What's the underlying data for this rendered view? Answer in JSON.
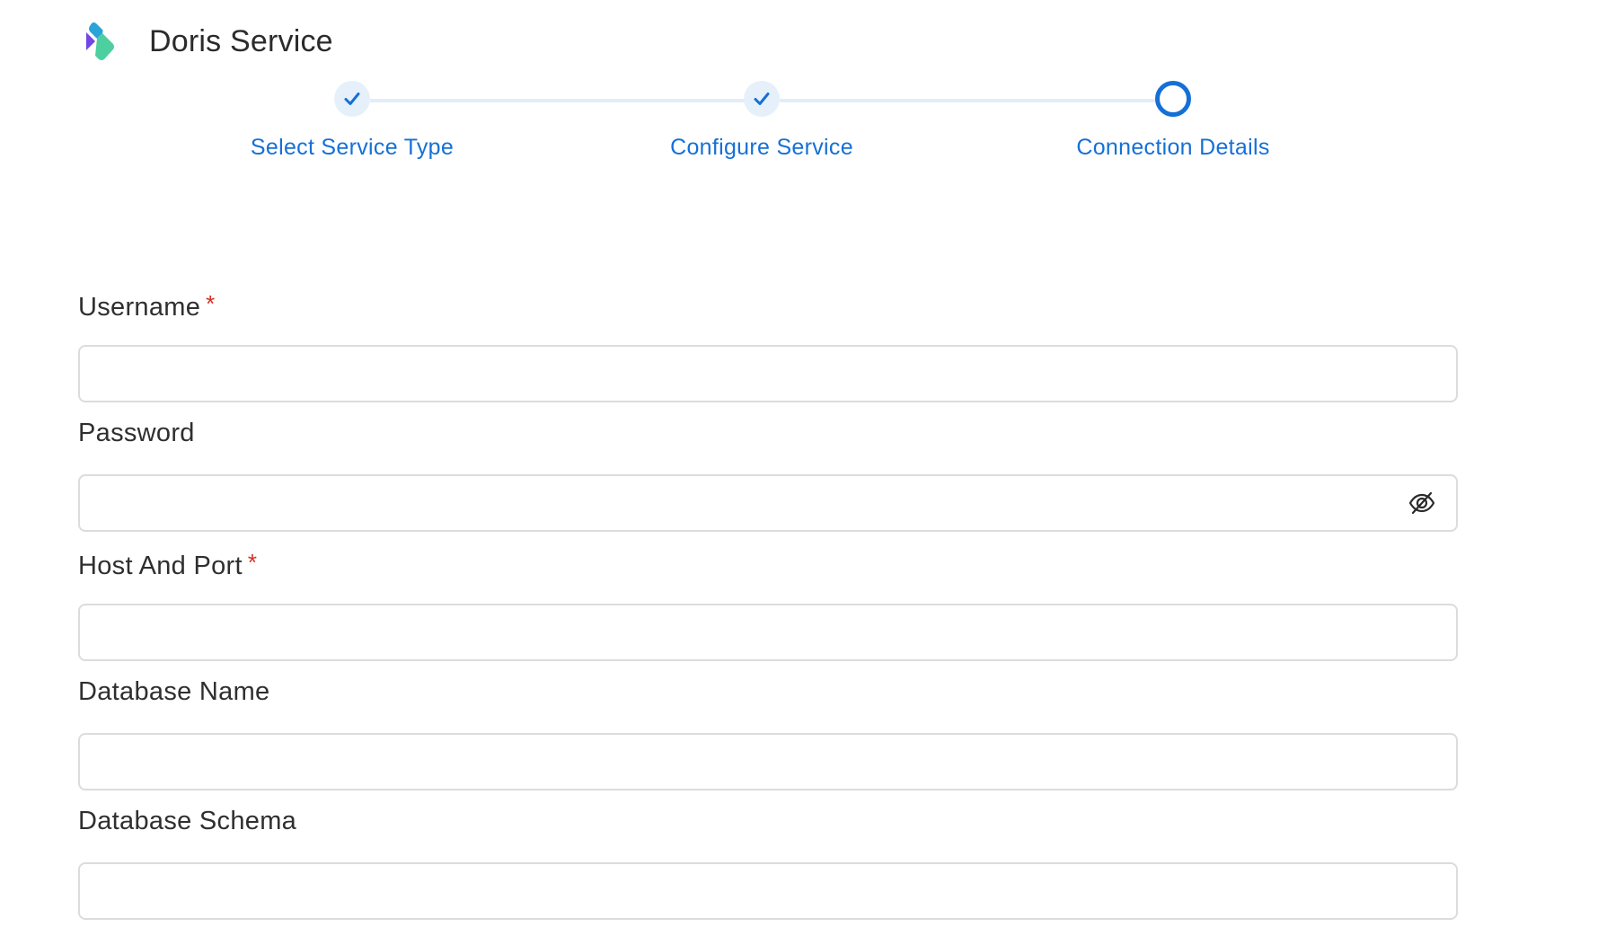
{
  "header": {
    "title": "Doris Service",
    "logo_icon": "openmetadata-logo-icon"
  },
  "stepper": {
    "steps": [
      {
        "label": "Select Service Type",
        "status": "completed"
      },
      {
        "label": "Configure Service",
        "status": "completed"
      },
      {
        "label": "Connection Details",
        "status": "current"
      }
    ],
    "accent_color": "#1570d6"
  },
  "form": {
    "fields": [
      {
        "label": "Username",
        "required_mark": "*",
        "value": "",
        "placeholder": ""
      },
      {
        "label": "Password",
        "value": "",
        "placeholder": "",
        "icon": "eye-slash-icon"
      },
      {
        "label": "Host And Port",
        "required_mark": "*",
        "value": "",
        "placeholder": ""
      },
      {
        "label": "Database Name",
        "value": "",
        "placeholder": ""
      },
      {
        "label": "Database Schema",
        "value": "",
        "placeholder": ""
      }
    ]
  }
}
